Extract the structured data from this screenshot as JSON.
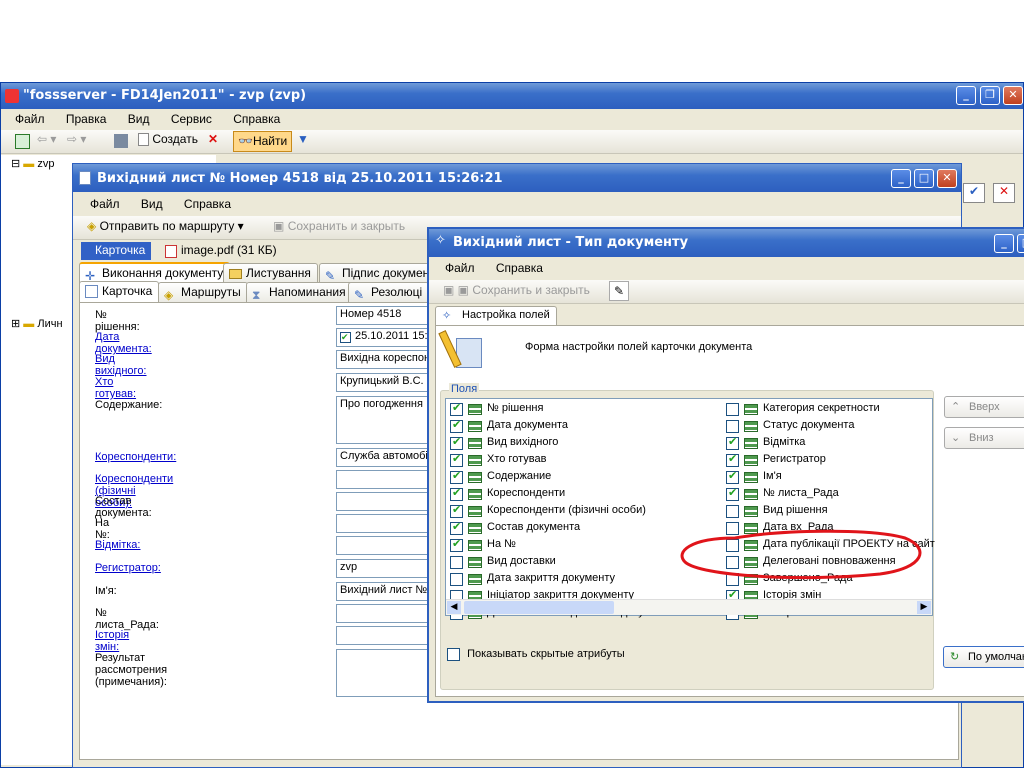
{
  "main_window": {
    "title": "\"fossserver - FD14Jen2011\" - zvp (zvp)",
    "menu": [
      "Файл",
      "Правка",
      "Вид",
      "Сервис",
      "Справка"
    ],
    "toolbar": {
      "create_label": "Создать",
      "find_label": "Найти"
    },
    "tree": [
      {
        "label": "zvp"
      },
      {
        "label": "Личн"
      }
    ]
  },
  "doc_window": {
    "title": "Вихідний лист № Номер 4518 від 25.10.2011 15:26:21",
    "menu": [
      "Файл",
      "Вид",
      "Справка"
    ],
    "toolbar": {
      "route_label": "Отправить по маршруту",
      "save_close_label": "Сохранить и закрыть"
    },
    "attach_tabs": {
      "card": "Карточка",
      "file": "image.pdf (31 КБ)"
    },
    "tabs_row1": [
      "Виконання документу",
      "Листування",
      "Підпис документ"
    ],
    "tabs_row2": [
      "Карточка",
      "Маршруты",
      "Напоминания",
      "Резолюці"
    ],
    "fields": [
      {
        "label": "№ рішення:",
        "value": "Номер 4518",
        "link": false
      },
      {
        "label": "Дата документа:",
        "value": "25.10.2011 15:",
        "link": true
      },
      {
        "label": "Вид вихідного:",
        "value": "Вихідна кореспон",
        "link": true
      },
      {
        "label": "Хто готував:",
        "value": "Крупицький В.С.",
        "link": true
      },
      {
        "label": "Содержание:",
        "value": "Про погодження",
        "link": false
      },
      {
        "label": "Кореспонденти:",
        "value": "Служба автомобі",
        "link": true
      },
      {
        "label": "Кореспонденти (фізичні особи):",
        "value": "",
        "link": true
      },
      {
        "label": "Состав документа:",
        "value": "",
        "link": false
      },
      {
        "label": "На №:",
        "value": "",
        "link": false
      },
      {
        "label": "Відмітка:",
        "value": "",
        "link": true
      },
      {
        "label": "Регистратор:",
        "value": "zvp",
        "link": true
      },
      {
        "label": "Ім'я:",
        "value": "Вихідний лист №",
        "link": false
      },
      {
        "label": "№ листа_Рада:",
        "value": "",
        "link": false
      },
      {
        "label": "Історія змін:",
        "value": "",
        "link": true
      },
      {
        "label": "Результат рассмотрения (примечания):",
        "value": "",
        "link": false
      }
    ]
  },
  "settings_window": {
    "title": "Вихідний лист - Тип документу",
    "menu": [
      "Файл",
      "Справка"
    ],
    "toolbar": {
      "save_close_label": "Сохранить и закрыть"
    },
    "tab": "Настройка полей",
    "header_text": "Форма настройки полей карточки документа",
    "group_label": "Поля",
    "fields_left": [
      {
        "label": "№ рішення",
        "checked": true
      },
      {
        "label": "Дата документа",
        "checked": true
      },
      {
        "label": "Вид вихідного",
        "checked": true
      },
      {
        "label": "Хто готував",
        "checked": true
      },
      {
        "label": "Содержание",
        "checked": true
      },
      {
        "label": "Кореспонденти",
        "checked": true
      },
      {
        "label": "Кореспонденти (фізичні особи)",
        "checked": true
      },
      {
        "label": "Состав документа",
        "checked": true
      },
      {
        "label": "На №",
        "checked": true
      },
      {
        "label": "Вид доставки",
        "checked": false
      },
      {
        "label": "Дата закриття документу",
        "checked": false
      },
      {
        "label": "Ініціатор закриття документу",
        "checked": false
      },
      {
        "label": "Дата окончания действия документа",
        "checked": false
      }
    ],
    "fields_right": [
      {
        "label": "Категория секретности",
        "checked": false
      },
      {
        "label": "Статус документа",
        "checked": false
      },
      {
        "label": "Відмітка",
        "checked": true
      },
      {
        "label": "Регистратор",
        "checked": true
      },
      {
        "label": "Ім'я",
        "checked": true
      },
      {
        "label": "№ листа_Рада",
        "checked": true
      },
      {
        "label": "Вид рішення",
        "checked": false
      },
      {
        "label": "Дата вх_Рада",
        "checked": false
      },
      {
        "label": "Дата публікації ПРОЕКТУ на сайт",
        "checked": false
      },
      {
        "label": "Делеговані повноваження",
        "checked": false
      },
      {
        "label": "Завершено_Рада",
        "checked": false
      },
      {
        "label": "Історія змін",
        "checked": true
      },
      {
        "label": "Контроль",
        "checked": false
      }
    ],
    "up_label": "Вверх",
    "down_label": "Вниз",
    "show_hidden_label": "Показывать скрытые атрибуты",
    "default_label": "По умолчан"
  },
  "colors": {
    "title_blue": "#2d5fbf",
    "window_bg": "#ece9d8",
    "annotation_red": "#e0141a",
    "link": "#0000cc"
  }
}
